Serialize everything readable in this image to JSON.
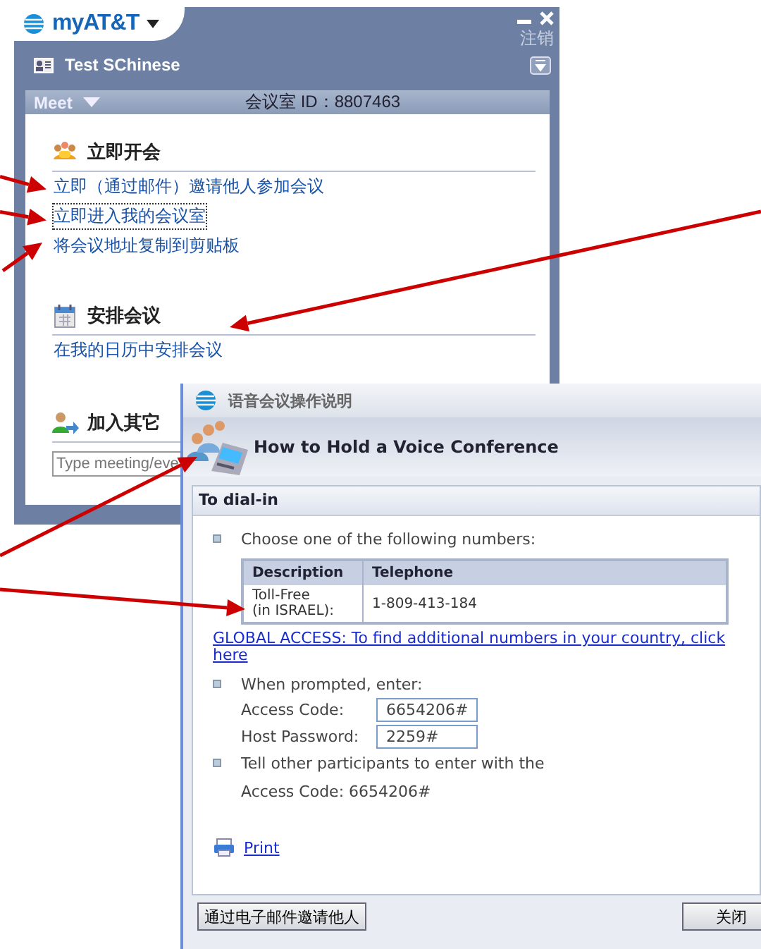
{
  "main_window": {
    "app_title": "myAT&T",
    "logout": "注销",
    "user_name": "Test SChinese",
    "meet_menu": "Meet",
    "room_id": "会议室 ID：8807463",
    "sections": [
      {
        "kind": "people",
        "title": "立即开会",
        "links": [
          {
            "text": "立即（通过邮件）邀请他人参加会议",
            "focused": false
          },
          {
            "text": "立即进入我的会议室",
            "focused": true
          },
          {
            "text": "将会议地址复制到剪贴板",
            "focused": false
          }
        ]
      },
      {
        "kind": "calendar",
        "title": "安排会议",
        "links": [
          {
            "text": "在我的日历中安排会议",
            "focused": false
          }
        ]
      },
      {
        "kind": "join",
        "title": "加入其它",
        "field": {
          "placeholder": "Type meeting/eve"
        }
      }
    ]
  },
  "dialog": {
    "title": "语音会议操作说明",
    "heading": "How to Hold a Voice Conference",
    "section_title": "To dial-in",
    "step_1": "Choose one of the following numbers:",
    "table": {
      "columns": [
        "Description",
        "Telephone"
      ],
      "rows": [
        [
          "Toll-Free\n(in ISRAEL):",
          "1-809-413-184"
        ]
      ]
    },
    "global_link": "GLOBAL ACCESS: To find additional numbers in your country, click here",
    "step_2": "When prompted, enter:",
    "fields": [
      {
        "label": "Access Code:",
        "value": "6654206#"
      },
      {
        "label": "Host Password:",
        "value": "2259#"
      }
    ],
    "step_3": "Tell other participants to enter with the",
    "step_3_code": "Access Code: 6654206#",
    "print": "Print",
    "buttons": [
      "通过电子邮件邀请他人",
      "关闭"
    ]
  }
}
